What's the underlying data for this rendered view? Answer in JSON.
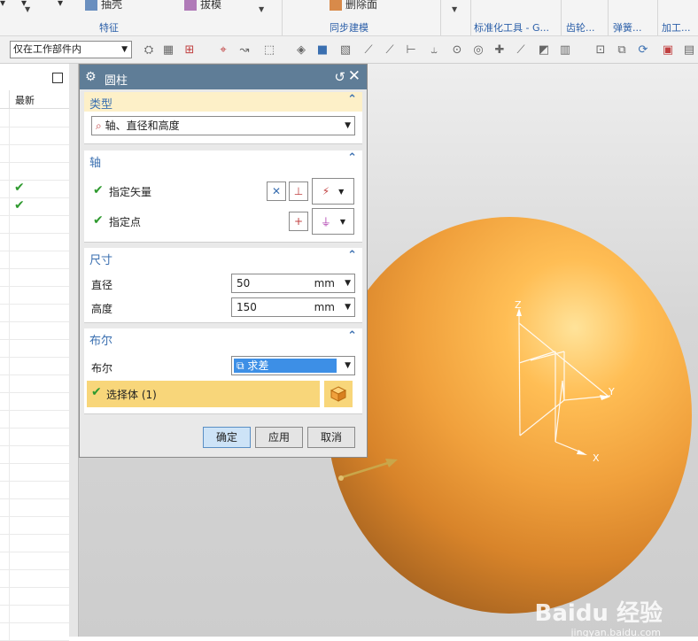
{
  "ribbon": {
    "fragments": [
      "抽壳",
      "拔模",
      "删除面"
    ],
    "groups": [
      "特征",
      "同步建模",
      "标准化工具 - G...",
      "齿轮...",
      "弹簧...",
      "加工..."
    ]
  },
  "toolbar": {
    "filter_value": "仅在工作部件内"
  },
  "navigator": {
    "column_header": "最新",
    "rows": [
      {
        "checked": false
      },
      {
        "checked": false
      },
      {
        "checked": false
      },
      {
        "checked": false
      },
      {
        "checked": true
      },
      {
        "checked": true
      },
      {
        "checked": false
      },
      {
        "checked": false
      },
      {
        "checked": false
      },
      {
        "checked": false
      },
      {
        "checked": false
      },
      {
        "checked": false
      },
      {
        "checked": false
      },
      {
        "checked": false
      },
      {
        "checked": false
      },
      {
        "checked": false
      },
      {
        "checked": false
      },
      {
        "checked": false
      },
      {
        "checked": false
      },
      {
        "checked": false
      },
      {
        "checked": false
      },
      {
        "checked": false
      },
      {
        "checked": false
      },
      {
        "checked": false
      },
      {
        "checked": false
      },
      {
        "checked": false
      },
      {
        "checked": false
      },
      {
        "checked": false
      },
      {
        "checked": false
      },
      {
        "checked": false
      }
    ]
  },
  "dialog": {
    "title": "圆柱",
    "type_section": {
      "label": "类型",
      "value": "轴、直径和高度"
    },
    "axis_section": {
      "label": "轴",
      "vector_label": "指定矢量",
      "point_label": "指定点"
    },
    "size_section": {
      "label": "尺寸",
      "diameter_label": "直径",
      "diameter_value": "50",
      "diameter_unit": "mm",
      "height_label": "高度",
      "height_value": "150",
      "height_unit": "mm"
    },
    "boolean_section": {
      "label": "布尔",
      "row_label": "布尔",
      "value": "求差",
      "select_body_label": "选择体 (1)"
    },
    "buttons": {
      "ok": "确定",
      "apply": "应用",
      "cancel": "取消"
    }
  },
  "viewport": {
    "axis_x": "X",
    "axis_y": "Y",
    "axis_z": "Z",
    "watermark": "Baidu 经验",
    "watermark_sub": "jingyan.baidu.com"
  },
  "colors": {
    "title_bar": "#5f7d97",
    "section_label": "#3a6fb0",
    "check": "#2f9a2f",
    "selection": "#f8d67a",
    "sphere": "#f0a03c"
  }
}
